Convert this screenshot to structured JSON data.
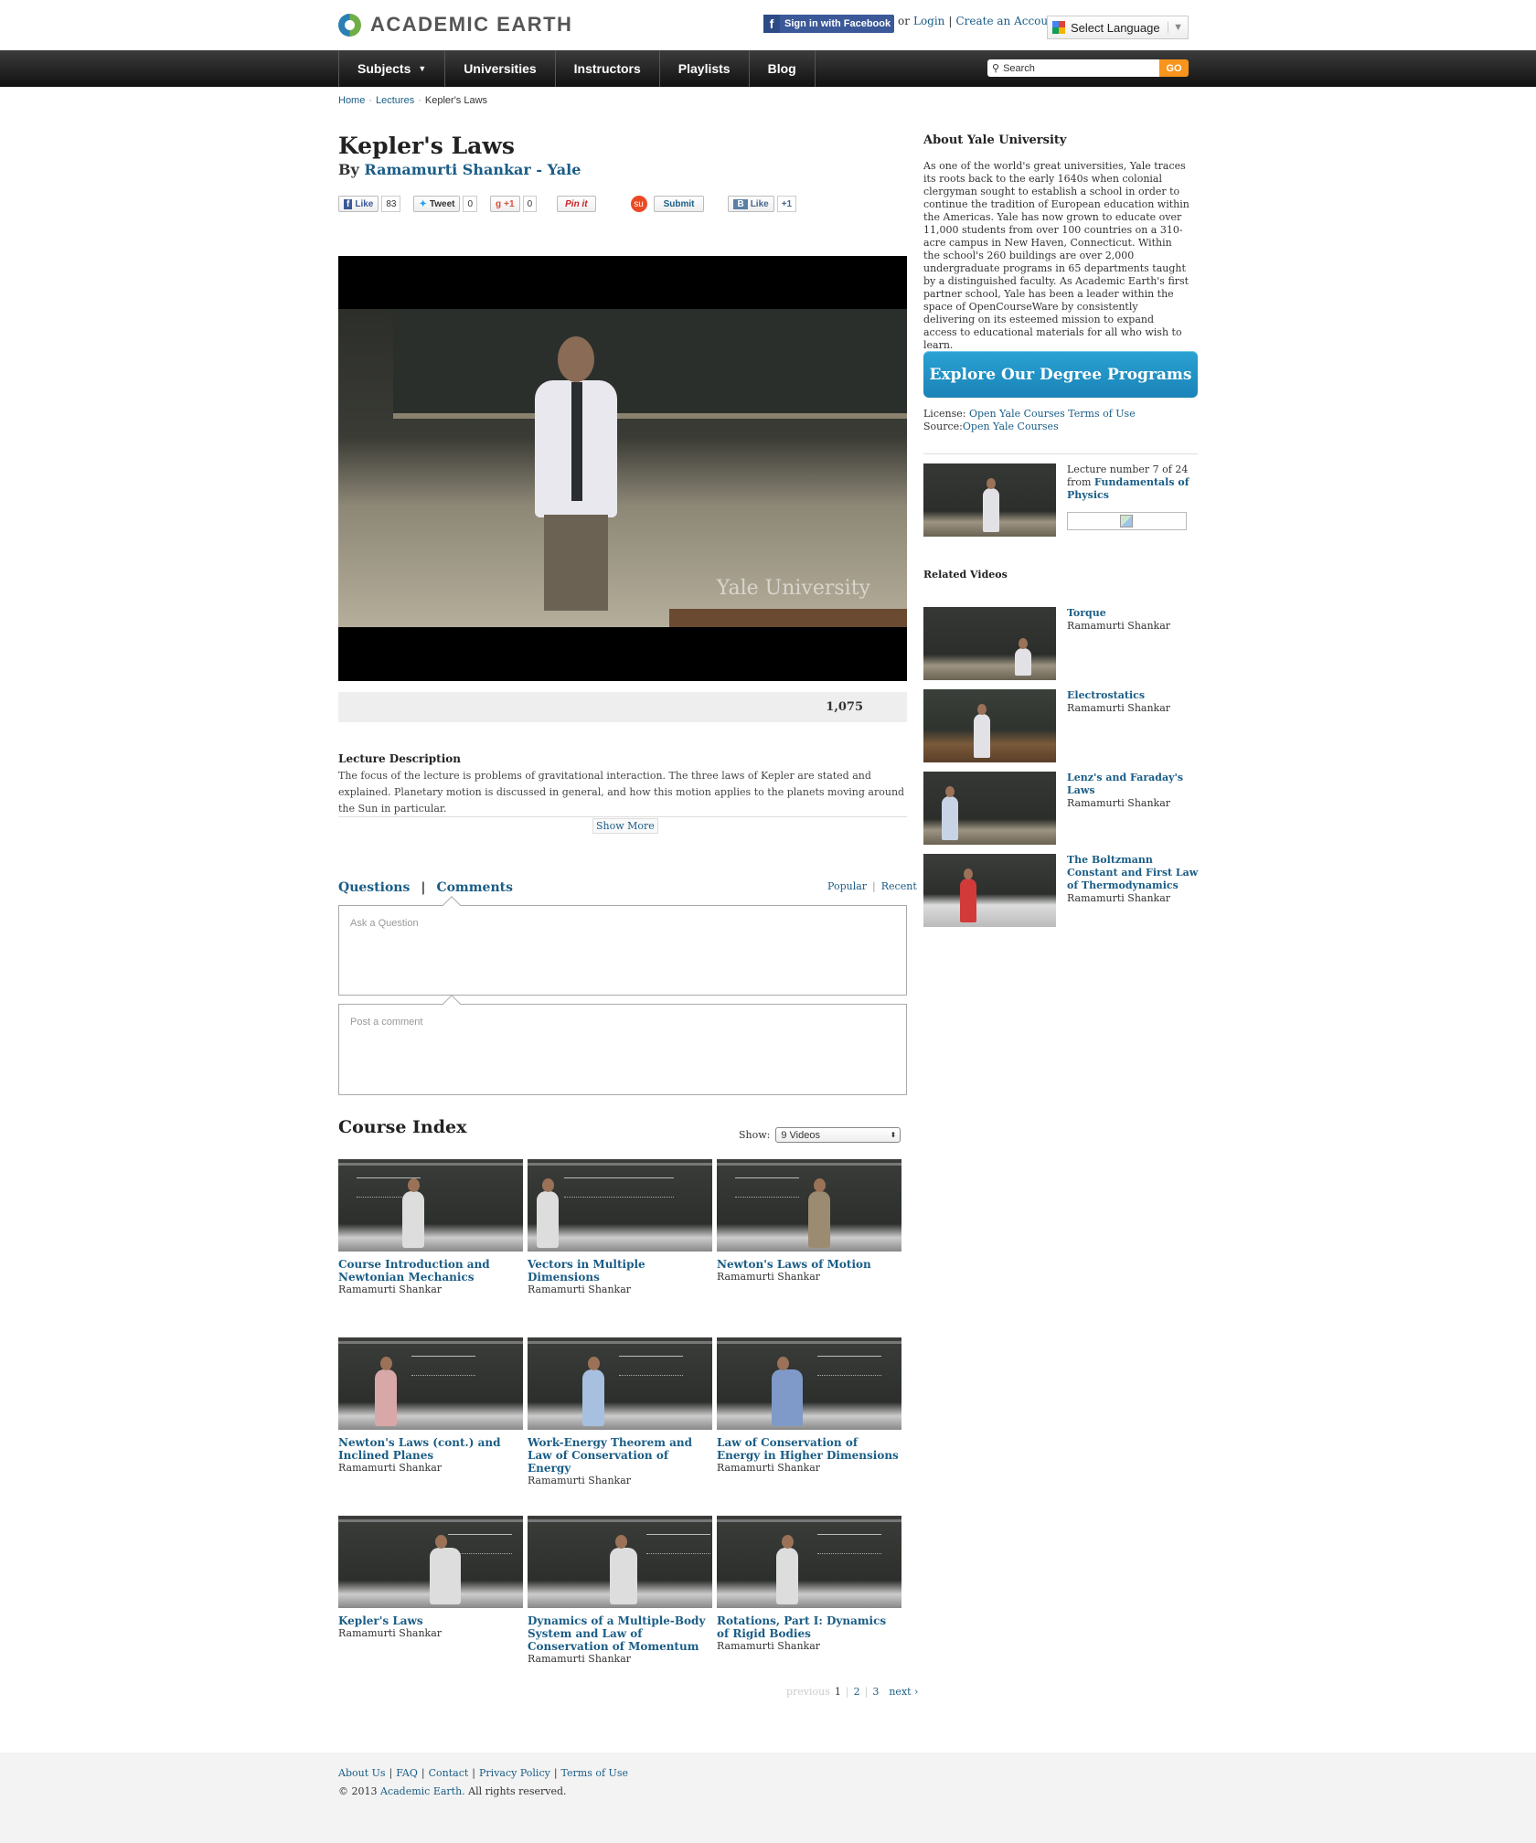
{
  "header": {
    "logo_text": "ACADEMIC EARTH",
    "facebook_button": "Sign in with Facebook",
    "or_text": "or",
    "login_link": "Login",
    "separator": "|",
    "create_account_link": "Create an Account",
    "language_select": "Select Language"
  },
  "nav": {
    "items": [
      {
        "label": "Subjects",
        "has_dropdown": true
      },
      {
        "label": "Universities"
      },
      {
        "label": "Instructors"
      },
      {
        "label": "Playlists"
      },
      {
        "label": "Blog"
      }
    ],
    "search_placeholder": "Search",
    "search_button": "GO"
  },
  "breadcrumb": {
    "items": [
      "Home",
      "Lectures",
      "Kepler's Laws"
    ],
    "separator": "·"
  },
  "lecture": {
    "title": "Kepler's Laws",
    "by_prefix": "By",
    "instructor": "Ramamurti Shankar - Yale",
    "video_watermark": "Yale University",
    "view_count": "1,075",
    "description_title": "Lecture Description",
    "description": "The focus of the lecture is problems of gravitational interaction. The three laws of Kepler are stated and explained. Planetary motion is discussed in general, and how this motion applies to the planets moving around the Sun in particular.",
    "show_more": "Show More"
  },
  "social": {
    "fb_like": "Like",
    "fb_count": "83",
    "tweet": "Tweet",
    "tweet_count": "0",
    "gplus": "+1",
    "gplus_count": "0",
    "pinit": "Pin it",
    "stumble": "Submit",
    "vk_like": "Like",
    "vk_plus": "+1"
  },
  "discussion": {
    "tab_questions": "Questions",
    "tab_separator": "|",
    "tab_comments": "Comments",
    "sort_popular": "Popular",
    "sort_separator": "|",
    "sort_recent": "Recent",
    "ask_placeholder": "Ask a Question",
    "comment_placeholder": "Post a comment"
  },
  "course_index": {
    "title": "Course Index",
    "show_label": "Show:",
    "show_value": "9 Videos",
    "cards": [
      {
        "title": "Course Introduction and Newtonian Mechanics",
        "author": "Ramamurti Shankar"
      },
      {
        "title": "Vectors in Multiple Dimensions",
        "author": "Ramamurti Shankar"
      },
      {
        "title": "Newton's Laws of Motion",
        "author": "Ramamurti Shankar"
      },
      {
        "title": "Newton's Laws (cont.) and Inclined Planes",
        "author": "Ramamurti Shankar"
      },
      {
        "title": "Work-Energy Theorem and Law of Conservation of Energy",
        "author": "Ramamurti Shankar"
      },
      {
        "title": "Law of Conservation of Energy in Higher Dimensions",
        "author": "Ramamurti Shankar"
      },
      {
        "title": "Kepler's Laws",
        "author": "Ramamurti Shankar"
      },
      {
        "title": "Dynamics of a Multiple-Body System and Law of Conservation of Momentum",
        "author": "Ramamurti Shankar"
      },
      {
        "title": "Rotations, Part I: Dynamics of Rigid Bodies",
        "author": "Ramamurti Shankar"
      }
    ],
    "pager": {
      "previous": "previous",
      "pages": [
        "1",
        "2",
        "3"
      ],
      "separator": "|",
      "next": "next ›"
    }
  },
  "sidebar": {
    "about_title": "About Yale University",
    "about_text": "As one of the world's great universities, Yale traces its roots back to the early 1640s when colonial clergyman sought to establish a school in order to continue the tradition of European education within the Americas. Yale has now grown to educate over 11,000 students from over 100 countries on a 310-acre campus in New Haven, Connecticut. Within the school's 260 buildings are over 2,000 undergraduate programs in 65 departments taught by a distinguished faculty. As Academic Earth's first partner school, Yale has been a leader within the space of OpenCourseWare by consistently delivering on its esteemed mission to expand access to educational materials for all who wish to learn.",
    "explore_button": "Explore Our Degree Programs",
    "license_label": "License:",
    "license_link": "Open Yale Courses Terms of Use",
    "source_label": "Source:",
    "source_link": "Open Yale Courses",
    "lecture_number_text": "Lecture number 7 of 24 from",
    "course_link": "Fundamentals of Physics",
    "related_title": "Related Videos",
    "related": [
      {
        "title": "Torque",
        "author": "Ramamurti Shankar"
      },
      {
        "title": "Electrostatics",
        "author": "Ramamurti Shankar"
      },
      {
        "title": "Lenz's and Faraday's Laws",
        "author": "Ramamurti Shankar"
      },
      {
        "title": "The Boltzmann Constant and First Law of Thermodynamics",
        "author": "Ramamurti Shankar"
      }
    ]
  },
  "footer": {
    "links": [
      "About Us",
      "FAQ",
      "Contact",
      "Privacy Policy",
      "Terms of Use"
    ],
    "separator": "|",
    "copyright_prefix": "© 2013",
    "copyright_link": "Academic Earth.",
    "copyright_suffix": "All rights reserved."
  }
}
